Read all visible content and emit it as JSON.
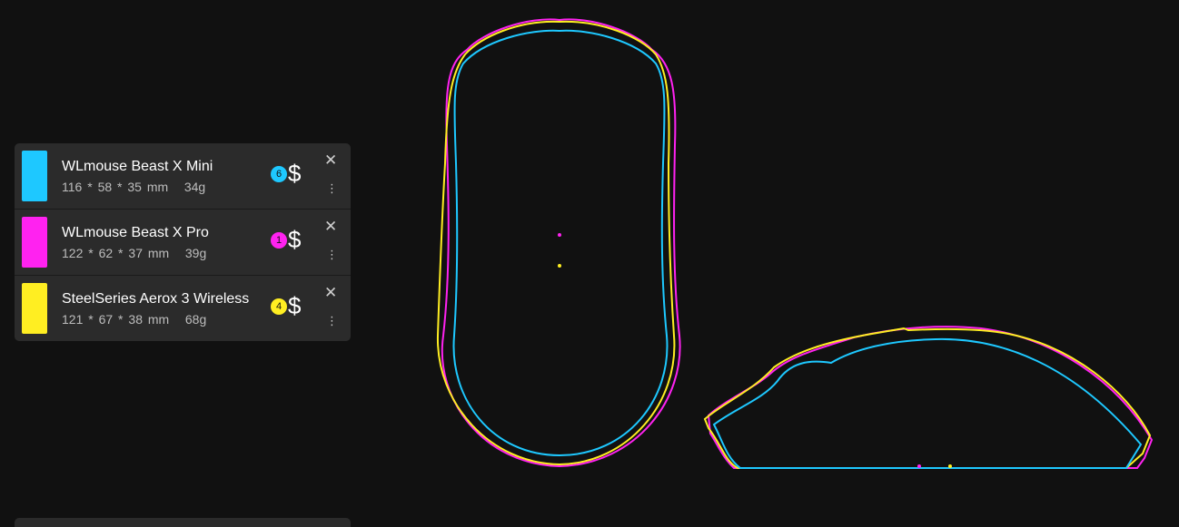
{
  "mice": [
    {
      "name": "WLmouse Beast X Mini",
      "length": "116",
      "width": "58",
      "height": "35",
      "unit": "mm",
      "weight": "34g",
      "rank": "6",
      "price_symbol": "$",
      "color": "#1ec8ff",
      "close_label": "✕",
      "menu_label": "⋮"
    },
    {
      "name": "WLmouse Beast X Pro",
      "length": "122",
      "width": "62",
      "height": "37",
      "unit": "mm",
      "weight": "39g",
      "rank": "1",
      "price_symbol": "$",
      "color": "#ff22f0",
      "close_label": "✕",
      "menu_label": "⋮"
    },
    {
      "name": "SteelSeries Aerox 3 Wireless",
      "length": "121",
      "width": "67",
      "height": "38",
      "unit": "mm",
      "weight": "68g",
      "rank": "4",
      "price_symbol": "$",
      "color": "#ffee22",
      "close_label": "✕",
      "menu_label": "⋮"
    }
  ],
  "icons": {
    "close": "close-icon",
    "menu": "more-vertical-icon",
    "price": "dollar-icon"
  },
  "views": [
    "top-view",
    "side-view"
  ]
}
